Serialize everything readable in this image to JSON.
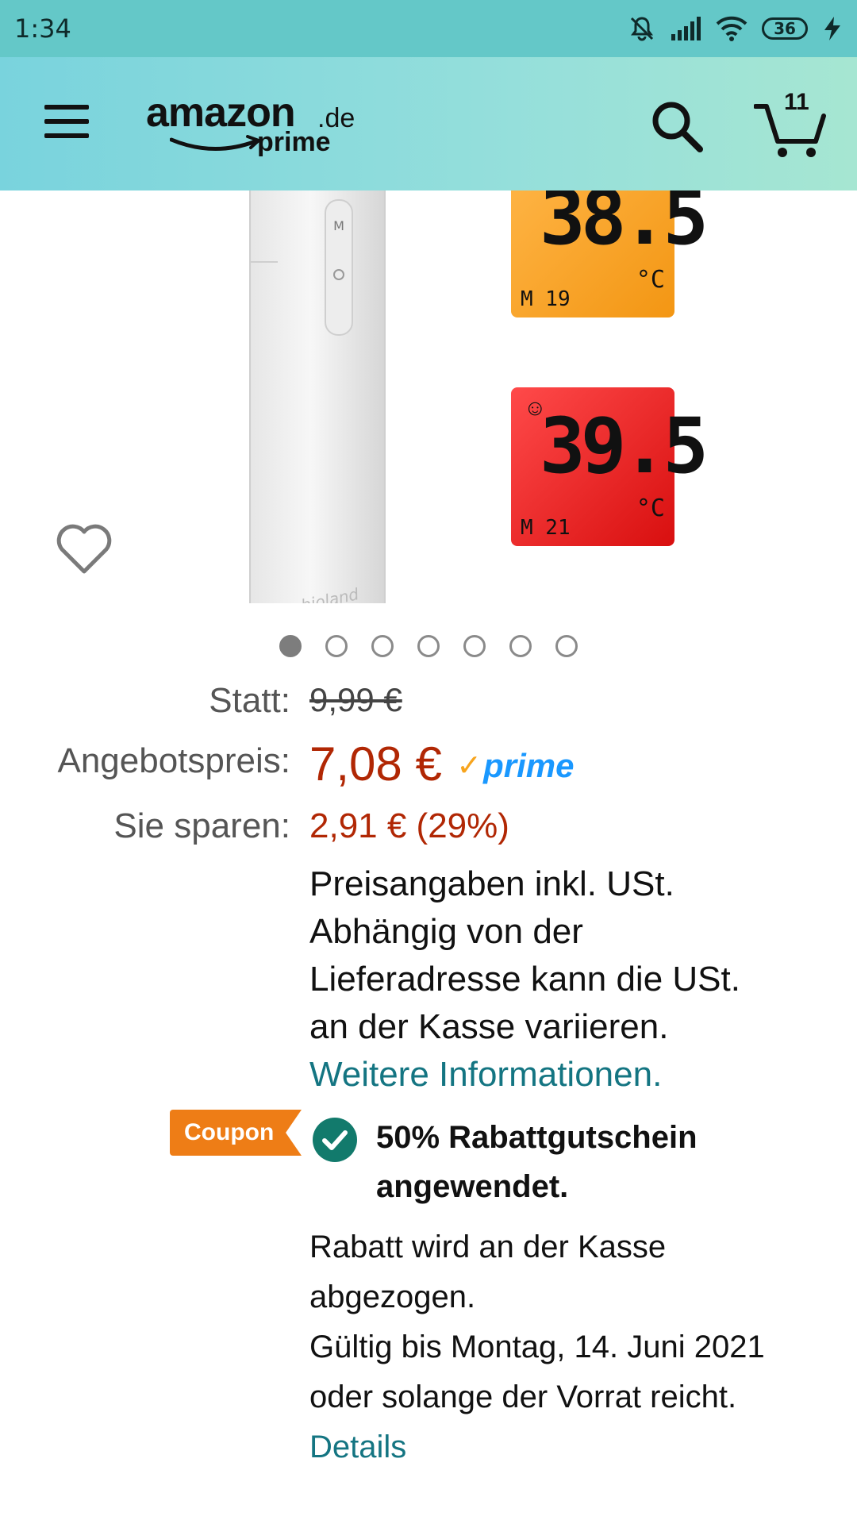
{
  "status_bar": {
    "time": "1:34",
    "battery": "36",
    "icons": [
      "bell-muted-icon",
      "signal-icon",
      "wifi-icon",
      "battery-icon",
      "charging-icon"
    ]
  },
  "header": {
    "logo_word": "amazon",
    "logo_tld": ".de",
    "logo_prime": "prime",
    "cart_count": "11",
    "colors": {
      "bar": "#8fdcd9",
      "status": "#64c8c8"
    }
  },
  "product_images": {
    "display_1": {
      "reading": "38.5",
      "memory": "M 19",
      "unit": "°C",
      "color": "#f39613"
    },
    "display_2": {
      "reading": "39.5",
      "memory": "M 21",
      "unit": "°C",
      "color": "#e01515"
    },
    "device_brand": "bioland",
    "device_buttons": [
      "M",
      "O"
    ],
    "carousel": {
      "count": 7,
      "active": 1
    }
  },
  "pricing": {
    "list_label": "Statt:",
    "list_price": "9,99 €",
    "deal_label": "Angebotspreis:",
    "deal_price": "7,08 €",
    "prime_text": "prime",
    "save_label": "Sie sparen:",
    "save_value": "2,91 € (29%)",
    "tax_lines": [
      "Preisangaben inkl. USt.",
      "Abhängig von der",
      "Lieferadresse kann die USt.",
      "an der Kasse variieren."
    ],
    "tax_link": "Weitere Informationen."
  },
  "coupon": {
    "tag": "Coupon",
    "title_line1": "50% Rabattgutschein",
    "title_line2": "angewendet.",
    "desc_lines": [
      "Rabatt wird an der Kasse",
      "abgezogen.",
      "Gültig bis Montag, 14. Juni 2021",
      "oder solange der Vorrat reicht."
    ],
    "details_link": "Details"
  }
}
